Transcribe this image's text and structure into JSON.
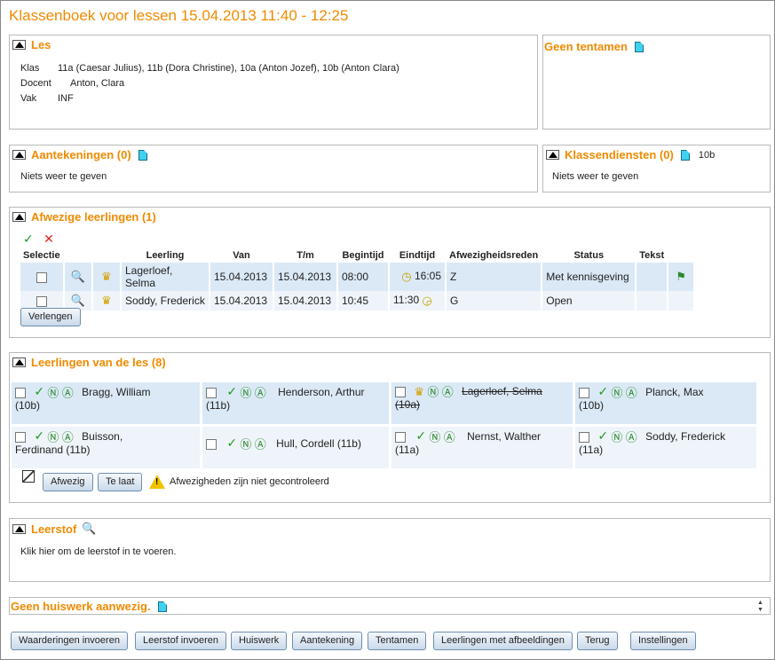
{
  "title": "Klassenboek voor lessen 15.04.2013 11:40 - 12:25",
  "les": {
    "header": "Les",
    "rows": [
      {
        "label": "Klas",
        "value": "11a (Caesar Julius), 11b (Dora Christine), 10a (Anton Jozef), 10b (Anton Clara)"
      },
      {
        "label": "Docent",
        "value": "Anton, Clara"
      },
      {
        "label": "Vak",
        "value": "INF"
      }
    ]
  },
  "tentamen": {
    "header": "Geen tentamen"
  },
  "aantekeningen": {
    "header": "Aantekeningen (0)",
    "text": "Niets weer te geven"
  },
  "klassendiensten": {
    "header": "Klassendiensten (0)",
    "klas": "10b",
    "text": "Niets weer te geven"
  },
  "afwezig": {
    "header": "Afwezige leerlingen (1)",
    "columns": [
      "Selectie",
      "",
      "",
      "Leerling",
      "Van",
      "T/m",
      "Begintijd",
      "Eindtijd",
      "Afwezigheidsreden",
      "Status",
      "Tekst",
      ""
    ],
    "rows": [
      {
        "leerling": "Lagerloef, Selma",
        "van": "15.04.2013",
        "tm": "15.04.2013",
        "begin": "08:00",
        "eind": "16:05",
        "reden": "Z",
        "status": "Met kennisgeving",
        "tekst": ""
      },
      {
        "leerling": "Soddy, Frederick",
        "van": "15.04.2013",
        "tm": "15.04.2013",
        "begin": "10:45",
        "eind": "11:30",
        "reden": "G",
        "status": "Open",
        "tekst": ""
      }
    ],
    "verlengen": "Verlengen"
  },
  "leerlingen": {
    "header": "Leerlingen van de les (8)",
    "students": [
      {
        "name": "Bragg, William",
        "klas": "(10b)",
        "absent": false
      },
      {
        "name": "Henderson, Arthur",
        "klas": "(11b)",
        "absent": false
      },
      {
        "name": "Lagerloef, Selma",
        "klas": "(10a)",
        "absent": true
      },
      {
        "name": "Planck, Max",
        "klas": "(10b)",
        "absent": false
      },
      {
        "name": "Buisson,",
        "name2": "Ferdinand (11b)",
        "klas": "",
        "absent": false
      },
      {
        "name": "Hull, Cordell (11b)",
        "klas": "",
        "absent": false
      },
      {
        "name": "Nernst, Walther",
        "klas": "(11a)",
        "absent": false
      },
      {
        "name": "Soddy, Frederick",
        "klas": "(11a)",
        "absent": false
      }
    ],
    "afwezig_btn": "Afwezig",
    "te_laat_btn": "Te laat",
    "warning": "Afwezigheden zijn niet gecontroleerd"
  },
  "leerstof": {
    "header": "Leerstof",
    "text": "Klik hier om de leerstof in te voeren."
  },
  "huiswerk": {
    "header": "Geen huiswerk aanwezig."
  },
  "buttons": [
    "Waarderingen invoeren",
    "Leerstof invoeren",
    "Huiswerk",
    "Aantekening",
    "Tentamen",
    "Leerlingen met afbeeldingen",
    "Terug",
    "Instellingen"
  ],
  "colors": {
    "accent": "#f08a00",
    "row_dark": "#dbe9f6",
    "row_light": "#eef4fa"
  }
}
